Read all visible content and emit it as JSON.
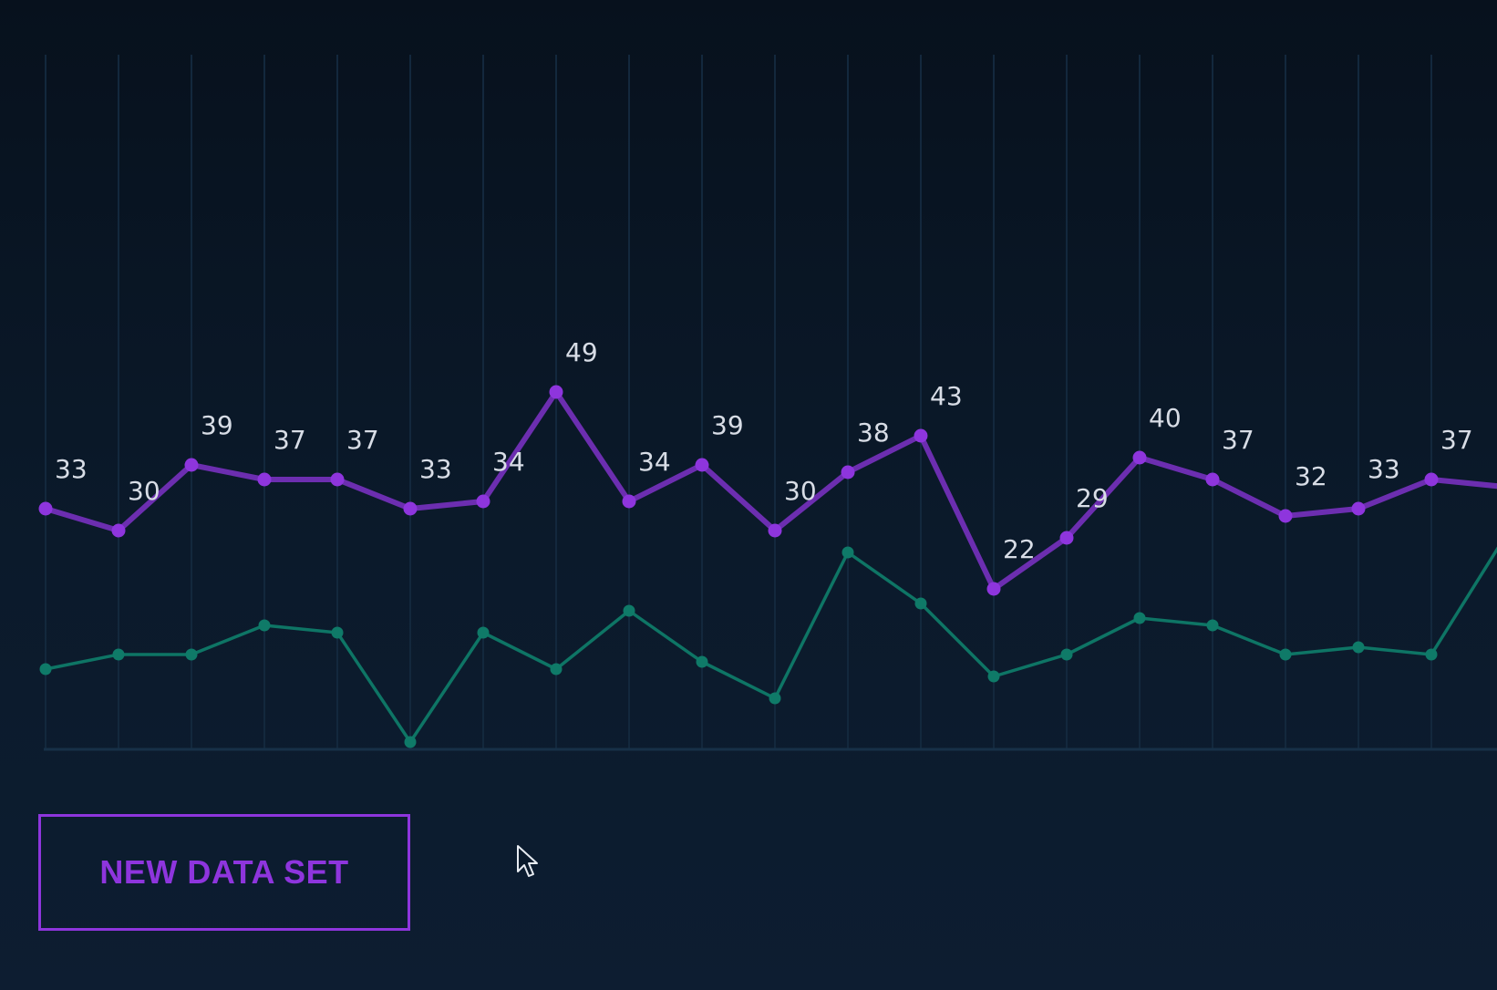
{
  "button": {
    "label": "NEW DATA SET"
  },
  "icons": {
    "cursor": "mouse-pointer-icon"
  },
  "colors": {
    "primary_series": "#8e35dd",
    "secondary_series": "#0f7a68",
    "grid": "#13283d",
    "label": "#d8dde6"
  },
  "chart_data": {
    "type": "line",
    "grid": "vertical",
    "legend": "none",
    "ylim": [
      0,
      100
    ],
    "x": [
      1,
      2,
      3,
      4,
      5,
      6,
      7,
      8,
      9,
      10,
      11,
      12,
      13,
      14,
      15,
      16,
      17,
      18,
      19,
      20,
      21
    ],
    "series": [
      {
        "values": [
          33,
          30,
          39,
          37,
          37,
          33,
          34,
          49,
          34,
          39,
          30,
          38,
          43,
          22,
          29,
          40,
          37,
          32,
          33,
          37,
          36
        ],
        "labels": [
          "33",
          "30",
          "39",
          "37",
          "37",
          "33",
          "34",
          "49",
          "34",
          "39",
          "30",
          "38",
          "43",
          "22",
          "29",
          "40",
          "37",
          "32",
          "33",
          "37",
          ""
        ],
        "color": "#8e35dd"
      },
      {
        "values": [
          11,
          13,
          13,
          17,
          16,
          1,
          16,
          11,
          19,
          12,
          7,
          27,
          20,
          10,
          13,
          18,
          17,
          13,
          14,
          13,
          29
        ],
        "color": "#0f7a68"
      }
    ]
  }
}
